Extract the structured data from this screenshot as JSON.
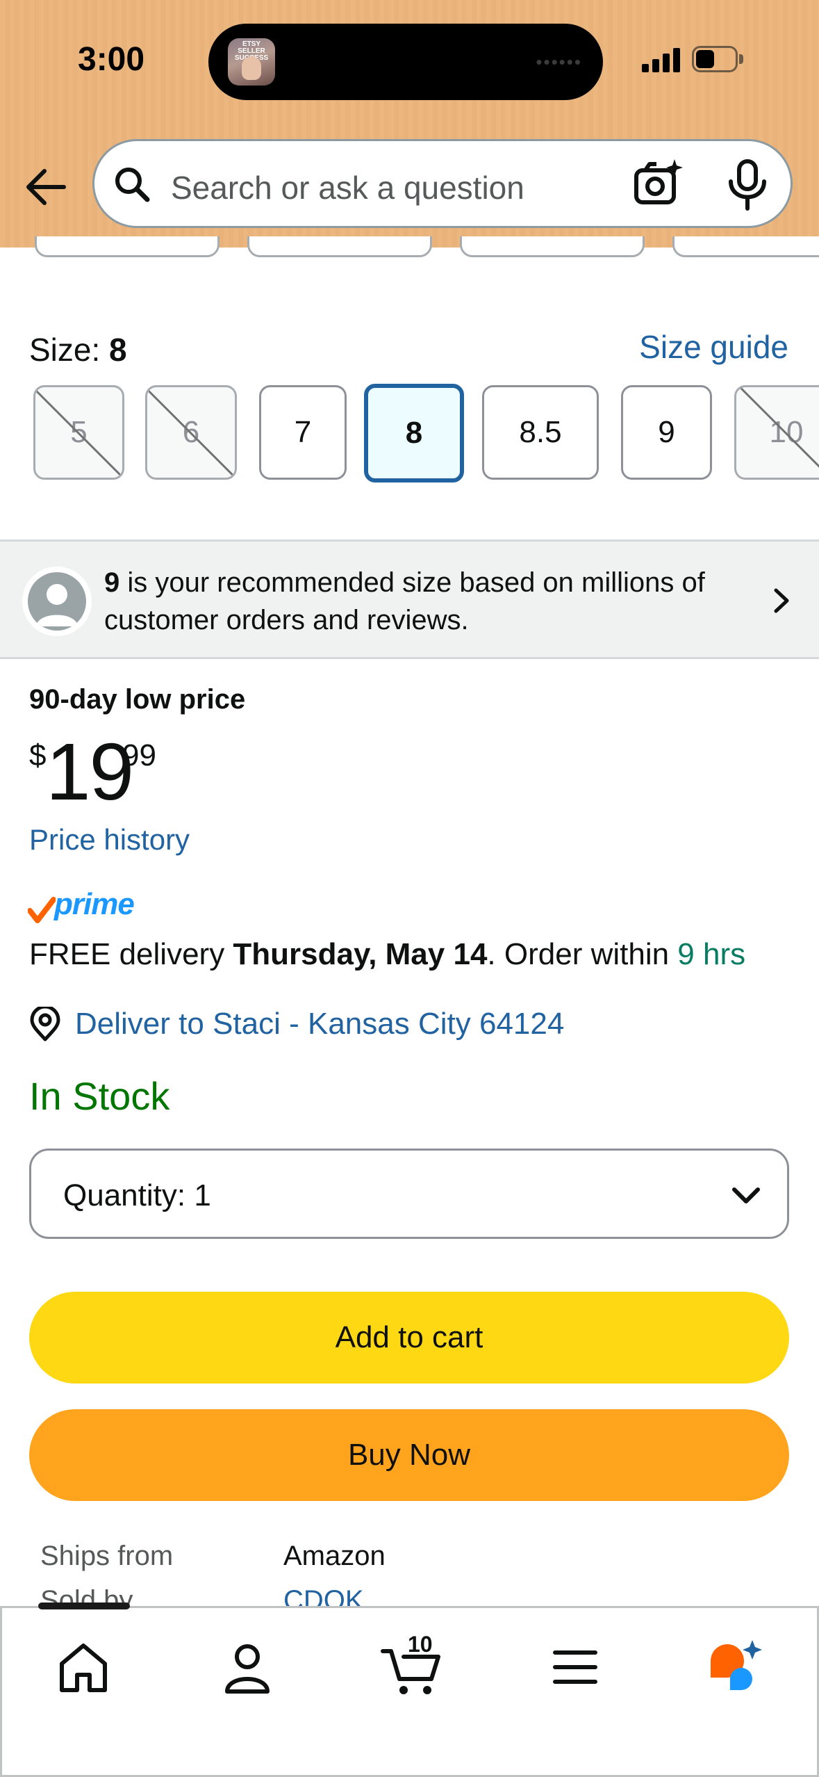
{
  "status_bar": {
    "time": "3:00",
    "live_activity_thumb_text": "ETSY SELLER SUCCESS",
    "live_activity_dots": "••••••"
  },
  "header": {
    "search_placeholder": "Search or ask a question",
    "background_color": "#ecb77f"
  },
  "size_selector": {
    "label": "Size:",
    "selected": "8",
    "guide_link": "Size guide",
    "options": [
      {
        "label": "5",
        "available": false
      },
      {
        "label": "6",
        "available": false
      },
      {
        "label": "7",
        "available": true
      },
      {
        "label": "8",
        "available": true,
        "selected": true
      },
      {
        "label": "8.5",
        "available": true
      },
      {
        "label": "9",
        "available": true
      },
      {
        "label": "10",
        "available": false
      }
    ]
  },
  "recommendation": {
    "size": "9",
    "text": " is your recommended size based on millions of customer orders and reviews."
  },
  "pricing": {
    "badge": "90-day low price",
    "currency": "$",
    "whole": "19",
    "fraction": "99",
    "history_link": "Price history"
  },
  "delivery": {
    "prime_label": "prime",
    "prefix": "FREE delivery ",
    "date": "Thursday, May 14",
    "order_within": ". Order within ",
    "time_left": "9 hrs",
    "deliver_to": "Deliver to Staci - Kansas City 64124"
  },
  "stock_status": "In Stock",
  "quantity": {
    "label": "Quantity:",
    "value": "1"
  },
  "actions": {
    "add_to_cart": "Add to cart",
    "buy_now": "Buy Now"
  },
  "seller_info": {
    "ships_from_label": "Ships from",
    "ships_from_value": "Amazon",
    "sold_by_label": "Sold by",
    "sold_by_value": "CDOK"
  },
  "bottom_nav": {
    "items": [
      "home-icon",
      "account-icon",
      "cart-icon",
      "menu-icon",
      "rufus-ai-icon"
    ],
    "cart_count": "10"
  },
  "colors": {
    "link": "#2162a1",
    "add_to_cart": "#ffd814",
    "buy_now": "#ffa41c",
    "in_stock": "#007600",
    "prime_blue": "#1a98ff"
  }
}
